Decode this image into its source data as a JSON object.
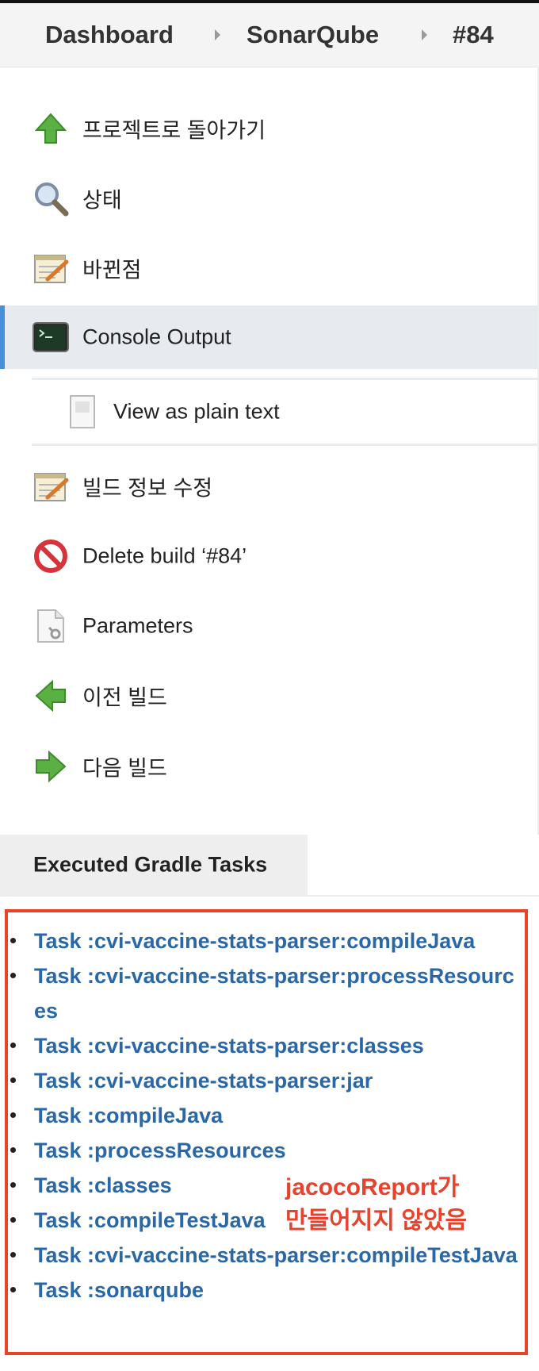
{
  "breadcrumb": {
    "items": [
      "Dashboard",
      "SonarQube",
      "#84"
    ]
  },
  "menu": {
    "back_to_project": "프로젝트로 돌아가기",
    "status": "상태",
    "changes": "바뀐점",
    "console_output": "Console Output",
    "view_plain_text": "View as plain text",
    "edit_build_info": "빌드 정보 수정",
    "delete_build": "Delete build ‘#84’",
    "parameters": "Parameters",
    "previous_build": "이전 빌드",
    "next_build": "다음 빌드"
  },
  "icons": {
    "back_to_project": "up-arrow-icon",
    "status": "magnifier-icon",
    "changes": "notepad-icon",
    "console_output": "terminal-icon",
    "view_plain_text": "document-icon",
    "edit_build_info": "notepad-icon",
    "delete_build": "no-entry-icon",
    "parameters": "parameters-document-icon",
    "previous_build": "left-arrow-icon",
    "next_build": "right-arrow-icon"
  },
  "gradle": {
    "title": "Executed Gradle Tasks",
    "tasks": [
      "Task :cvi-vaccine-stats-parser:compileJava",
      "Task :cvi-vaccine-stats-parser:processResources",
      "Task :cvi-vaccine-stats-parser:classes",
      "Task :cvi-vaccine-stats-parser:jar",
      "Task :compileJava",
      "Task :processResources",
      "Task :classes",
      "Task :compileTestJava",
      "Task :cvi-vaccine-stats-parser:compileTestJava",
      "Task :sonarqube"
    ]
  },
  "annotation": {
    "line1": "jacocoReport가",
    "line2": "만들어지지 않았음"
  },
  "colors": {
    "link": "#2a67a6",
    "highlight": "#e8412c",
    "active_bar": "#4a90d9"
  }
}
